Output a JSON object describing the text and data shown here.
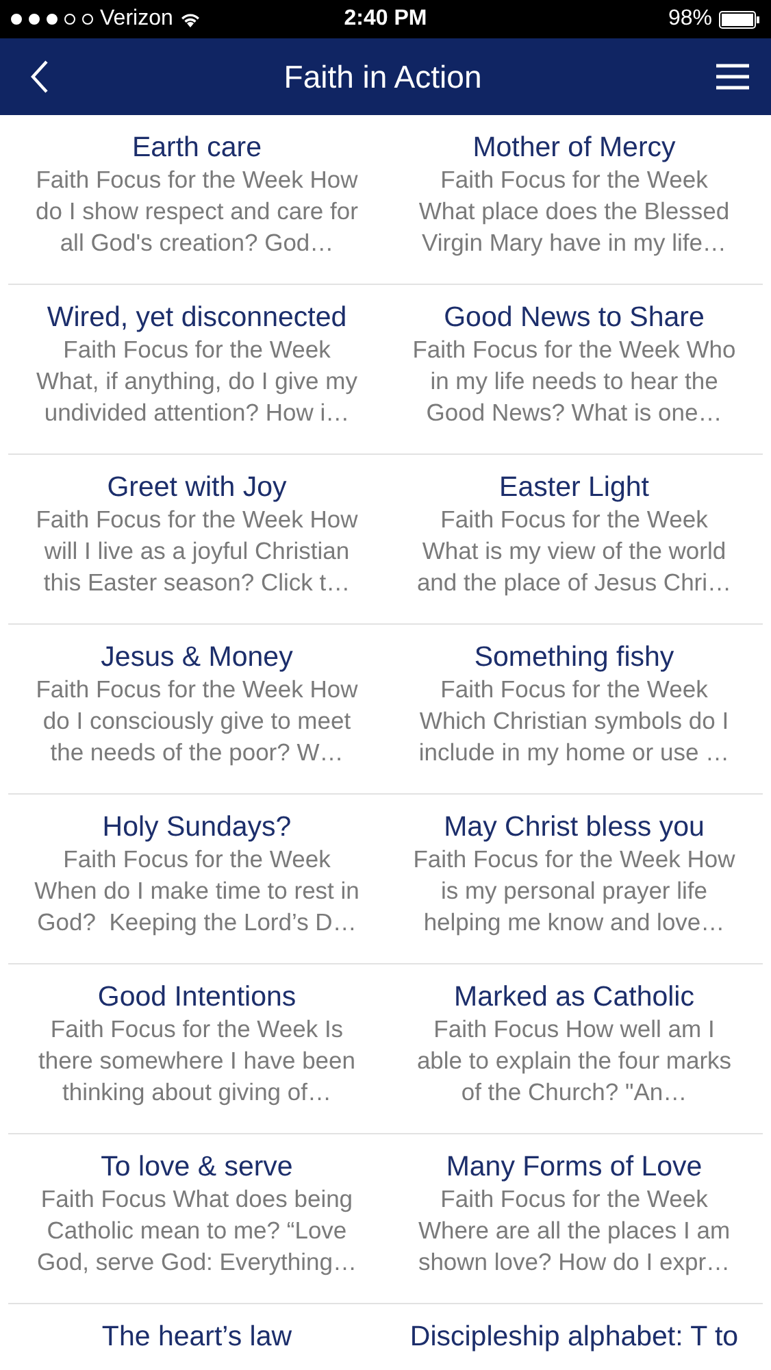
{
  "status_bar": {
    "carrier": "Verizon",
    "time": "2:40 PM",
    "battery": "98%",
    "signal_bars": [
      {
        "on": true
      },
      {
        "on": true
      },
      {
        "on": true
      },
      {
        "on": false
      },
      {
        "on": false
      }
    ]
  },
  "nav_bar": {
    "title": "Faith in Action"
  },
  "articles": [
    {
      "title": "Earth care",
      "summary": "Faith Focus for the Week How\ndo I show respect and care for\nall God's creation? God…"
    },
    {
      "title": "Mother of Mercy",
      "summary": "Faith Focus for the Week\nWhat place does the Blessed\nVirgin Mary have in my life…"
    },
    {
      "title": "Wired, yet disconnected",
      "summary": "Faith Focus for the Week\nWhat, if anything, do I give my\nundivided attention? How i…"
    },
    {
      "title": "Good News to Share",
      "summary": "Faith Focus for the Week Who\nin my life needs to hear the\nGood News? What is one…"
    },
    {
      "title": "Greet with Joy",
      "summary": "Faith Focus for the Week How\nwill I live as a joyful Christian\nthis Easter season? Click t…"
    },
    {
      "title": "Easter Light",
      "summary": "Faith Focus for the Week\nWhat is my view of the world\nand the place of Jesus Chri…"
    },
    {
      "title": "Jesus & Money",
      "summary": "Faith Focus for the Week How\ndo I consciously give to meet\nthe needs of the poor? W…"
    },
    {
      "title": "Something fishy",
      "summary": "Faith Focus for the Week\nWhich Christian symbols do I\ninclude in my home or use …"
    },
    {
      "title": "Holy Sundays?",
      "summary": "Faith Focus for the Week\nWhen do I make time to rest in\nGod?  Keeping the Lord’s D…"
    },
    {
      "title": "May Christ bless you",
      "summary": "Faith Focus for the Week How\nis my personal prayer life\nhelping me know and love…"
    },
    {
      "title": "Good Intentions",
      "summary": "Faith Focus for the Week Is\nthere somewhere I have been\nthinking about giving of…"
    },
    {
      "title": "Marked as Catholic",
      "summary": "Faith Focus How well am I\nable to explain the four marks\nof the Church? \"An…"
    },
    {
      "title": "To love & serve",
      "summary": "Faith Focus What does being\nCatholic mean to me? “Love\nGod, serve God: Everything…"
    },
    {
      "title": "Many Forms of Love",
      "summary": "Faith Focus for the Week\nWhere are all the places I am\nshown love? How do I expr…"
    },
    {
      "title": "The heart’s law"
    },
    {
      "title": "Discipleship alphabet: T to"
    }
  ]
}
